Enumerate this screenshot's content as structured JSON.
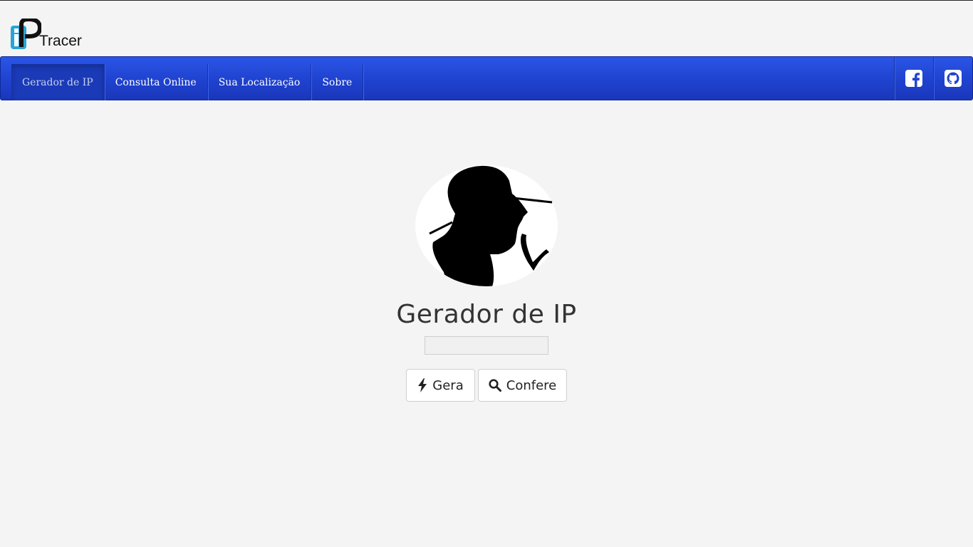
{
  "brand": {
    "logo_text": "Tracer",
    "logo_mark": "iP"
  },
  "nav": {
    "items": [
      {
        "label": "Gerador de IP",
        "active": true
      },
      {
        "label": "Consulta Online",
        "active": false
      },
      {
        "label": "Sua Localização",
        "active": false
      },
      {
        "label": "Sobre",
        "active": false
      }
    ],
    "social": [
      {
        "icon": "facebook-icon"
      },
      {
        "icon": "github-icon"
      }
    ],
    "colors": {
      "bar": "#1f42cf",
      "active": "#1a3ab8"
    }
  },
  "main": {
    "avatar": "detective-silhouette-icon",
    "title": "Gerador de IP",
    "ip_value": "",
    "buttons": {
      "generate_label": "Gera",
      "generate_icon": "bolt-icon",
      "check_label": "Confere",
      "check_icon": "search-icon"
    }
  }
}
